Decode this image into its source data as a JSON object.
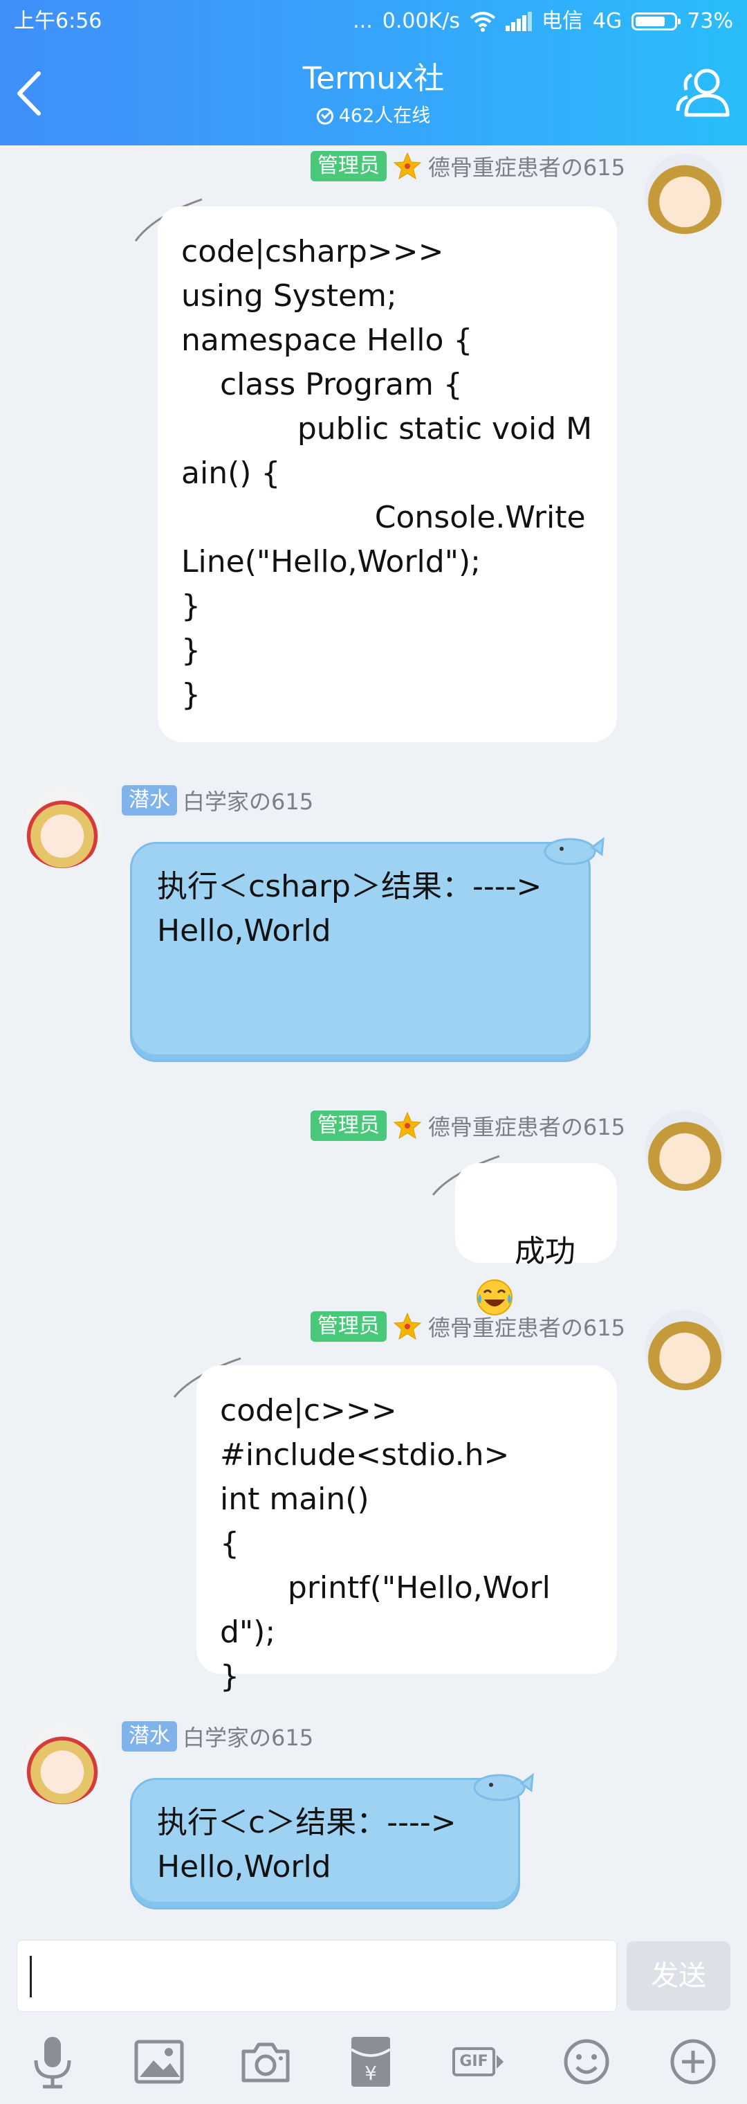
{
  "status_bar": {
    "time": "上午6:56",
    "dots": "...",
    "speed": "0.00K/s",
    "carrier": "电信",
    "network": "4G",
    "battery": "73%"
  },
  "header": {
    "title": "Termux社",
    "online": "462人在线"
  },
  "messages": [
    {
      "badge": "管理员",
      "sender": "德骨重症患者の615",
      "text": "code|csharp>>>\nusing System;\nnamespace Hello {\n    class Program {\n            public static void Main() {\n                    Console.WriteLine(\"Hello,World\");\n}\n}\n}"
    },
    {
      "badge": "潜水",
      "sender": "白学家の615",
      "text": "执行＜csharp＞结果：---->\nHello,World"
    },
    {
      "badge": "管理员",
      "sender": "德骨重症患者の615",
      "text": "成功"
    },
    {
      "badge": "管理员",
      "sender": "德骨重症患者の615",
      "text": "code|c>>>\n#include<stdio.h>\nint main()\n{\n       printf(\"Hello,World\");\n}"
    },
    {
      "badge": "潜水",
      "sender": "白学家の615",
      "text": "执行＜c＞结果：---->\nHello,World"
    }
  ],
  "input": {
    "value": "",
    "send_label": "发送"
  },
  "toolbar": {
    "gif_label": "GIF"
  },
  "colors": {
    "header_start": "#3f8ff8",
    "header_end": "#29bdfb",
    "admin_badge": "#48c97a",
    "lurker_badge": "#7fb3ea",
    "blue_bubble": "#9dd2f3"
  }
}
